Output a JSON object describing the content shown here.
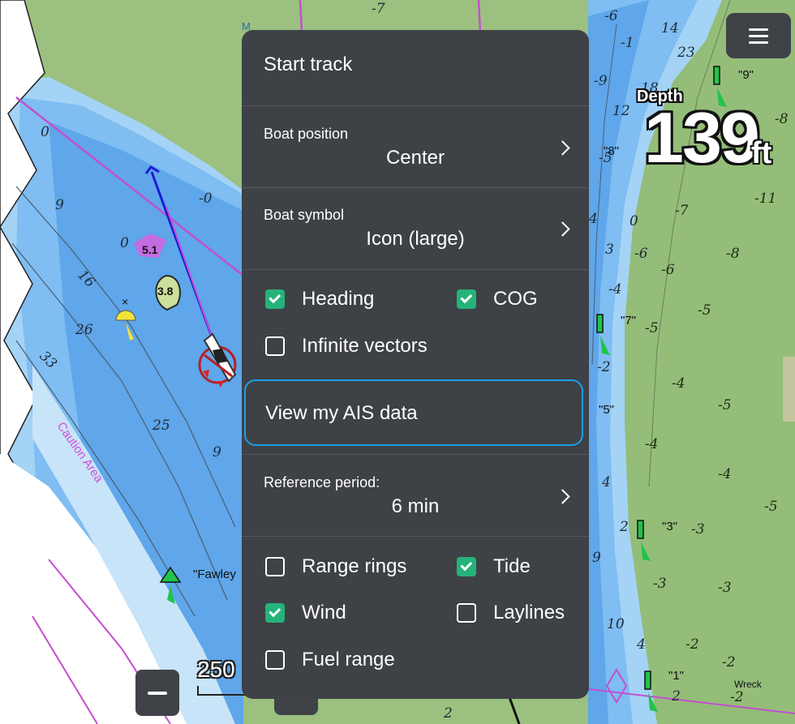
{
  "menu": {
    "start_track": "Start track",
    "boat_position": {
      "label": "Boat position",
      "value": "Center"
    },
    "boat_symbol": {
      "label": "Boat symbol",
      "value": "Icon (large)"
    },
    "checkboxes_top": [
      {
        "label": "Heading",
        "checked": true
      },
      {
        "label": "COG",
        "checked": true
      },
      {
        "label": "Infinite vectors",
        "checked": false
      }
    ],
    "view_ais": "View my AIS data",
    "reference_period": {
      "label": "Reference period:",
      "value": "6 min"
    },
    "checkboxes_bottom": [
      {
        "label": "Range rings",
        "checked": false
      },
      {
        "label": "Tide",
        "checked": true
      },
      {
        "label": "Wind",
        "checked": true
      },
      {
        "label": "Laylines",
        "checked": false
      },
      {
        "label": "Fuel range",
        "checked": false
      }
    ]
  },
  "depth": {
    "label": "Depth",
    "value": "139",
    "unit": "ft"
  },
  "scale": {
    "value": "250"
  },
  "map": {
    "caution_area": "Caution Area",
    "buoy_labels": [
      "\"9\"",
      "\"8\"",
      "\"7\"",
      "\"5\"",
      "\"3\"",
      "\"1\"",
      "\"Fawley"
    ],
    "wreck": "Wreck",
    "top_letter": "M",
    "markers": {
      "purple": "5.1",
      "green": "3.8"
    },
    "soundings_water": [
      "0",
      "9",
      "-0",
      "0",
      "16",
      "26",
      "33",
      "25",
      "9",
      "-6",
      "14",
      "-1",
      "23",
      "-9",
      "18",
      "12",
      "-5",
      "4",
      "0",
      "3",
      "-6",
      "-4",
      "-2",
      "4",
      "2",
      "9",
      "10",
      "4",
      "2",
      "2",
      "-7"
    ],
    "soundings_land": [
      "-8",
      "-11",
      "-7",
      "-8",
      "-6",
      "-5",
      "-5",
      "-4",
      "-5",
      "-4",
      "-4",
      "-5",
      "-3",
      "-3",
      "-3",
      "-2",
      "-2",
      "-2"
    ],
    "colors": {
      "land": "#9bc07f",
      "deep_water": "#a4d3f6",
      "mid_water": "#7fbdf2",
      "shallow_water": "#5fa6ea",
      "channel": "#c24fd0",
      "menu_bg": "#3e4146",
      "check_green": "#25b37a",
      "highlight": "#1aa0e8"
    }
  }
}
